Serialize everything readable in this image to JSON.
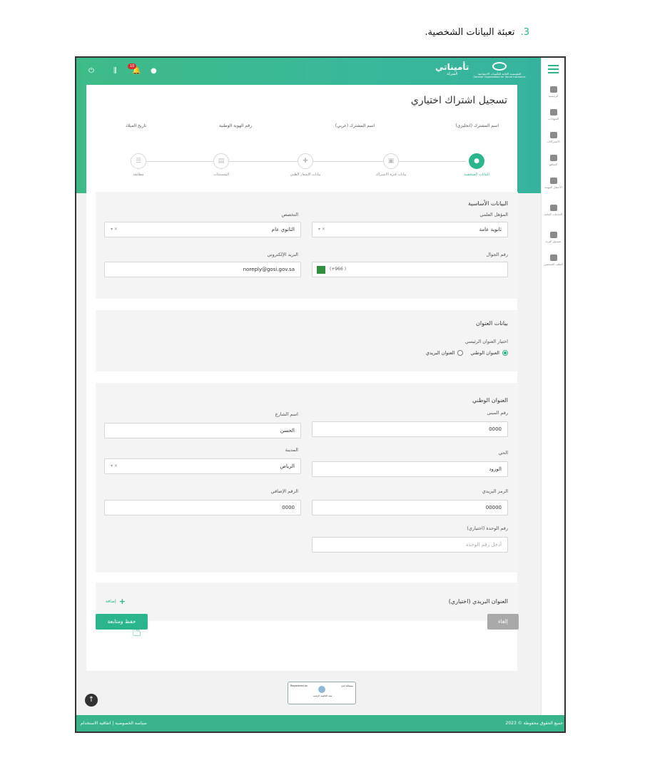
{
  "step_heading": {
    "number": "3.",
    "text": "تعبئة البيانات الشخصية."
  },
  "header": {
    "brand_ameni": "تأميناتي",
    "brand_ameni_sub": "الشركة",
    "brand_gosi_ar": "المؤسسة العامة للتأمينات الاجتماعية",
    "brand_gosi_en": "General Organization for Social Insurance",
    "notification_count": "10"
  },
  "sidebar": {
    "items": [
      {
        "label": "الرئيسية",
        "icon": "home-icon"
      },
      {
        "label": "الشهادات",
        "icon": "certificate-icon"
      },
      {
        "label": "الاشتراكات",
        "icon": "subscriptions-icon"
      },
      {
        "label": "المنافع",
        "icon": "benefits-icon"
      },
      {
        "label": "الأخطار المهنية",
        "icon": "hazards-icon"
      },
      {
        "label": "الخدمات العامة",
        "icon": "folder-icon"
      },
      {
        "label": "صندوق البريد",
        "icon": "mailbox-icon"
      },
      {
        "label": "الملف الشخصي",
        "icon": "profile-icon"
      }
    ]
  },
  "page": {
    "title": "تسجيل اشتراك اختياري",
    "info_labels": [
      "اسم المشترك (انجليزي)",
      "اسم المشترك (عربي)",
      "رقم الهوية الوطنية",
      "تاريخ الميلاد"
    ]
  },
  "stepper": {
    "steps": [
      {
        "label": "البيانات الشخصية",
        "icon": "user-icon",
        "active": true
      },
      {
        "label": "بيانات فترة الاشتراك",
        "icon": "briefcase-icon",
        "active": false
      },
      {
        "label": "بيانات الإشعار الطبي",
        "icon": "medical-icon",
        "active": false
      },
      {
        "label": "المستندات",
        "icon": "document-icon",
        "active": false
      },
      {
        "label": "مطابقة",
        "icon": "checklist-icon",
        "active": false
      }
    ]
  },
  "basic_info": {
    "title": "البيانات الأساسية",
    "qualification_label": "المؤهل العلمي",
    "qualification_value": "ثانوية عامة",
    "specialization_label": "التخصص",
    "specialization_value": "الثانوي عام",
    "mobile_label": "رقم الجوال",
    "mobile_prefix": "(+966 )",
    "email_label": "البريد الإلكتروني",
    "email_value": "noreply@gosi.gov.sa"
  },
  "address_info": {
    "title": "بيانات العنوان",
    "choose_label": "اختيار العنوان الرئيسي",
    "option_national": "العنوان الوطني",
    "option_postal": "العنوان البريدي"
  },
  "national_address": {
    "title": "العنوان الوطني",
    "building_label": "رقم المبنى",
    "building_value": "0000",
    "street_label": "اسم الشارع",
    "street_value": "الحسن",
    "district_label": "الحي",
    "district_value": "الورود",
    "city_label": "المدينة",
    "city_value": "الرياض",
    "postal_label": "الرمز البريدي",
    "postal_value": "00000",
    "additional_label": "الرقم الإضافي",
    "additional_value": "0000",
    "unit_label": "رقم الوحدة (اختياري)",
    "unit_placeholder": "أدخل رقم الوحدة"
  },
  "postal_address": {
    "title": "العنوان البريدي (اختياري)",
    "add_label": "إضافة"
  },
  "actions": {
    "save": "حفظ ومتابعة",
    "cancel": "إلغاء"
  },
  "registered_badge": {
    "left": "Registered on",
    "right": "مسجلة لدى",
    "bottom": "هيئة الحكومة الرقمية"
  },
  "footer": {
    "links": "سياسة الخصوصية | اتفاقية الاستخدام",
    "copyright": "جميع الحقوق محفوظة © 2023"
  }
}
